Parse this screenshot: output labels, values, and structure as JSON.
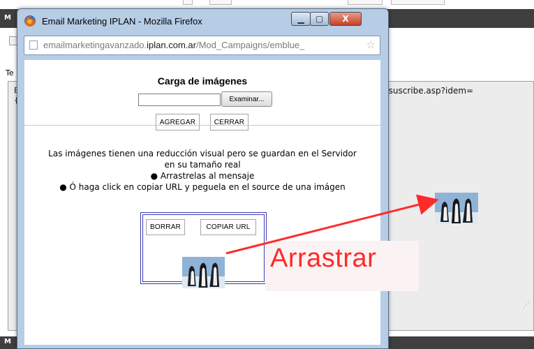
{
  "background_page": {
    "header_letter": "M",
    "label_te": "Te",
    "editor_line1": "E",
    "editor_line2": "{",
    "unsubscribe_text": "nsuscribe.asp?idem=",
    "footer_letter": "M",
    "grip": "⋰"
  },
  "popup": {
    "window_title": "Email Marketing IPLAN - Mozilla Firefox",
    "buttons": {
      "minimize": "▁",
      "maximize": "▢",
      "close": "X"
    },
    "url_prefix": "emailmarketingavanzado.",
    "url_domain": "iplan.com.ar",
    "url_suffix": "/Mod_Campaigns/emblue_",
    "star": "☆",
    "content": {
      "title": "Carga de imágenes",
      "browse_button": "Examinar...",
      "add_button": "AGREGAR",
      "close_button": "CERRAR",
      "info_line1": "Las imágenes tienen una reducción visual pero se guardan en el Servidor",
      "info_line2": "en su tamaño real",
      "bullet1": "● Arrastrelas al mensaje",
      "bullet2": "● Ó haga click en copiar URL y peguela en el source de una imágen",
      "delete_button": "BORRAR",
      "copy_url_button": "COPIAR URL"
    }
  },
  "annotation": {
    "label": "Arrastrar",
    "color": "#ff2a2a"
  },
  "colors": {
    "window_frame": "#b7cde6",
    "dark_bar": "#3f3f3f",
    "drop_border": "#3a3ab0"
  },
  "icons": [
    "firefox-logo-icon",
    "page-icon",
    "star-icon",
    "penguin-thumbnail-icon",
    "arrow-icon"
  ]
}
